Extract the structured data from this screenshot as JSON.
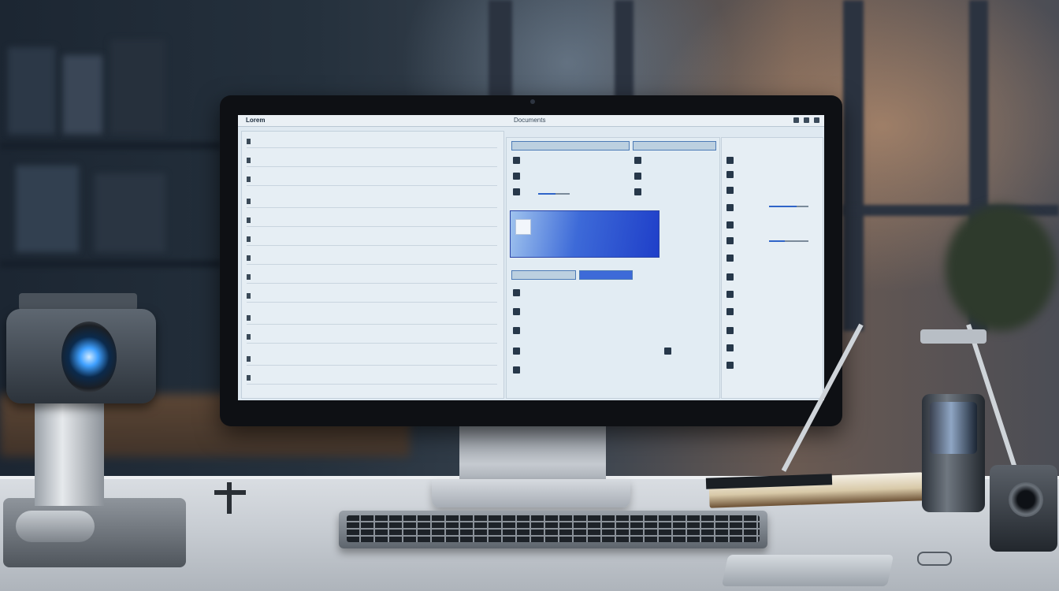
{
  "screen": {
    "app_title": "Lorem",
    "center_title": "Documents"
  },
  "colors": {
    "accent_blue": "#3d6ad8",
    "screen_bg": "#dfe9f1",
    "camera_lens": "#3fa0ff"
  },
  "icons": [
    "camera-icon",
    "file-icon",
    "window-control-icon"
  ]
}
